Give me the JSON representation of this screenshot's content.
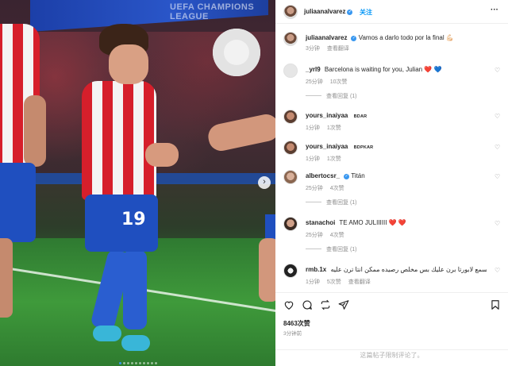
{
  "photo": {
    "banner_text": "UEFA CHAMPIONS LEAGUE",
    "jersey_number": "19",
    "next_icon": "›",
    "carousel_dots": 10,
    "carousel_active": 1
  },
  "header": {
    "username": "juliaanalvarez",
    "follow_label": "关注",
    "more_icon": "···"
  },
  "caption": {
    "username": "juliaanalvarez",
    "text": "Vamos a darlo todo por la final 💪🏻",
    "time": "3分钟",
    "translate": "查看翻译"
  },
  "comments": [
    {
      "username": "_yrl9",
      "text": "Barcelona is waiting for you, Julian",
      "emoji": "❤️ 💙",
      "time": "25分钟",
      "likes": "10次赞",
      "reply": "",
      "view_replies": "查看回复 (1)"
    },
    {
      "username": "yours_inaiyaa",
      "tag": "BDAR",
      "text": "",
      "time": "1分钟",
      "likes": "1次赞",
      "reply": "",
      "view_replies": ""
    },
    {
      "username": "yours_inaiyaa",
      "tag": "BDPKAR",
      "text": "",
      "time": "1分钟",
      "likes": "1次赞",
      "reply": "",
      "view_replies": ""
    },
    {
      "username": "albertocsr_",
      "verified": true,
      "text": "Titán",
      "time": "25分钟",
      "likes": "4次赞",
      "reply": "",
      "view_replies": "查看回复 (1)"
    },
    {
      "username": "stanachoi",
      "text": "TE AMO JULIIIIII",
      "emoji": "❤️ ❤️",
      "time": "25分钟",
      "likes": "4次赞",
      "reply": "",
      "view_replies": "查看回复 (1)"
    },
    {
      "username": "rmb.1x",
      "text": "اسمع لابورتا برن عليك بس مخلص رصيده ممكن انتا ترن عليه",
      "time": "1分钟",
      "likes": "5次赞",
      "reply": "",
      "translate": "查看翻译"
    }
  ],
  "actions": {
    "like_icon": "heart-outline",
    "comment_icon": "speech-bubble",
    "share_icon": "repost",
    "send_icon": "paper-plane",
    "save_icon": "bookmark",
    "likes": "8463次赞",
    "time_ago": "3分钟前"
  },
  "footer": {
    "limited_text": "这篇帖子限制评论了。"
  },
  "colors": {
    "link_blue": "#0095f6",
    "heart_red": "#ed4956",
    "muted": "#8e8e8e"
  }
}
